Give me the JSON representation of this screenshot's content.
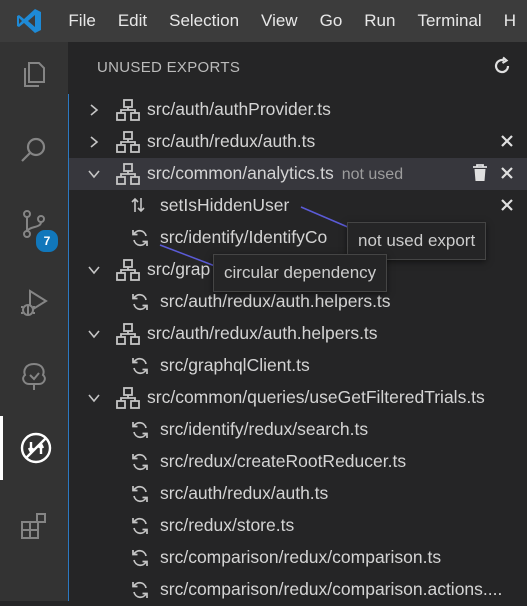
{
  "menubar": {
    "items": [
      "File",
      "Edit",
      "Selection",
      "View",
      "Go",
      "Run",
      "Terminal",
      "H"
    ]
  },
  "activitybar": {
    "source_control_badge": "7",
    "icons": [
      "explorer-icon",
      "search-icon",
      "source-control-icon",
      "run-debug-icon",
      "tree-icon",
      "unused-exports-icon",
      "extensions-icon"
    ]
  },
  "sidebar": {
    "title": "UNUSED EXPORTS",
    "tree": [
      {
        "label": "src/auth/authProvider.ts",
        "expanded": false
      },
      {
        "label": "src/auth/redux/auth.ts",
        "expanded": false
      },
      {
        "label": "src/common/analytics.ts",
        "note": "not used",
        "expanded": true
      },
      {
        "label": "setIsHiddenUser"
      },
      {
        "label": "src/identify/IdentifyCo"
      },
      {
        "label": "src/grap",
        "expanded": true
      },
      {
        "label": "src/auth/redux/auth.helpers.ts"
      },
      {
        "label": "src/auth/redux/auth.helpers.ts",
        "expanded": true
      },
      {
        "label": "src/graphqlClient.ts"
      },
      {
        "label": "src/common/queries/useGetFilteredTrials.ts",
        "expanded": true
      },
      {
        "label": "src/identify/redux/search.ts"
      },
      {
        "label": "src/redux/createRootReducer.ts"
      },
      {
        "label": "src/auth/redux/auth.ts"
      },
      {
        "label": "src/redux/store.ts"
      },
      {
        "label": "src/comparison/redux/comparison.ts"
      },
      {
        "label": "src/comparison/redux/comparison.actions...."
      }
    ],
    "tooltips": {
      "unused": "not used export",
      "circular": "circular dependency"
    }
  },
  "colors": {
    "accent": "#2b79c2",
    "badge": "#1177bb",
    "logo": "#1e8ad6",
    "annotation_line": "#5b5bd6"
  }
}
